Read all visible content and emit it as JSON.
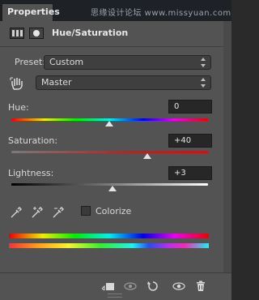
{
  "tab": {
    "label": "Properties"
  },
  "watermark": "思缘设计论坛 www.missyuan.com",
  "panel": {
    "title": "Hue/Saturation"
  },
  "preset": {
    "label": "Preset:",
    "value": "Custom"
  },
  "channel": {
    "value": "Master"
  },
  "hue": {
    "label": "Hue:",
    "value": "0",
    "level": 0
  },
  "saturation": {
    "label": "Saturation:",
    "value": "+40",
    "level": 40
  },
  "lightness": {
    "label": "Lightness:",
    "value": "+3",
    "level": 3
  },
  "colorize": {
    "label": "Colorize",
    "checked": false
  },
  "icons": {
    "adjustment": "adjustment-layer-icon",
    "mask": "mask-icon",
    "hand": "on-image-adjust-hand-icon",
    "eyedropper1": "eyedropper-icon",
    "eyedropper2": "add-eyedropper-icon",
    "eyedropper3": "subtract-eyedropper-icon",
    "clip": "clip-to-layer-icon",
    "view_prev": "view-previous-state-icon",
    "reset": "reset-icon",
    "visibility": "visibility-eye-icon",
    "trash": "trash-icon"
  }
}
